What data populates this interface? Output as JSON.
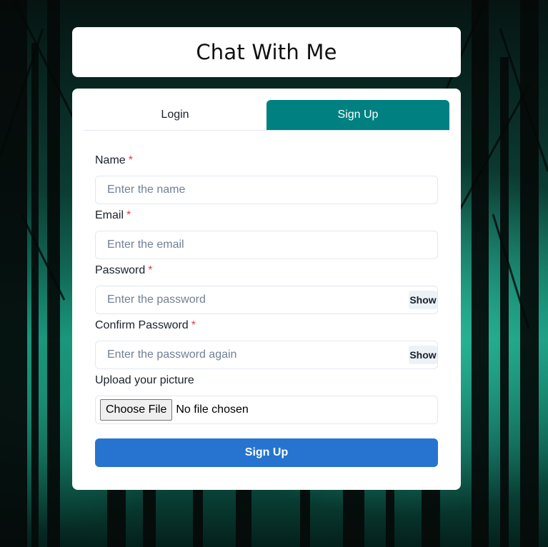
{
  "app": {
    "title": "Chat With Me"
  },
  "tabs": [
    {
      "label": "Login",
      "active": false
    },
    {
      "label": "Sign Up",
      "active": true
    }
  ],
  "form": {
    "name": {
      "label": "Name",
      "required_mark": "*",
      "placeholder": "Enter the name",
      "value": ""
    },
    "email": {
      "label": "Email",
      "required_mark": "*",
      "placeholder": "Enter the email",
      "value": ""
    },
    "password": {
      "label": "Password",
      "required_mark": "*",
      "placeholder": "Enter the password",
      "value": "",
      "toggle_label": "Show"
    },
    "confirm_password": {
      "label": "Confirm Password",
      "required_mark": "*",
      "placeholder": "Enter the password again",
      "value": "",
      "toggle_label": "Show"
    },
    "picture": {
      "label": "Upload your picture",
      "button_label": "Choose File",
      "status": "No file chosen"
    },
    "submit_label": "Sign Up"
  },
  "colors": {
    "accent_tab": "#008080",
    "submit": "#2674d0",
    "required": "#e53e3e"
  }
}
